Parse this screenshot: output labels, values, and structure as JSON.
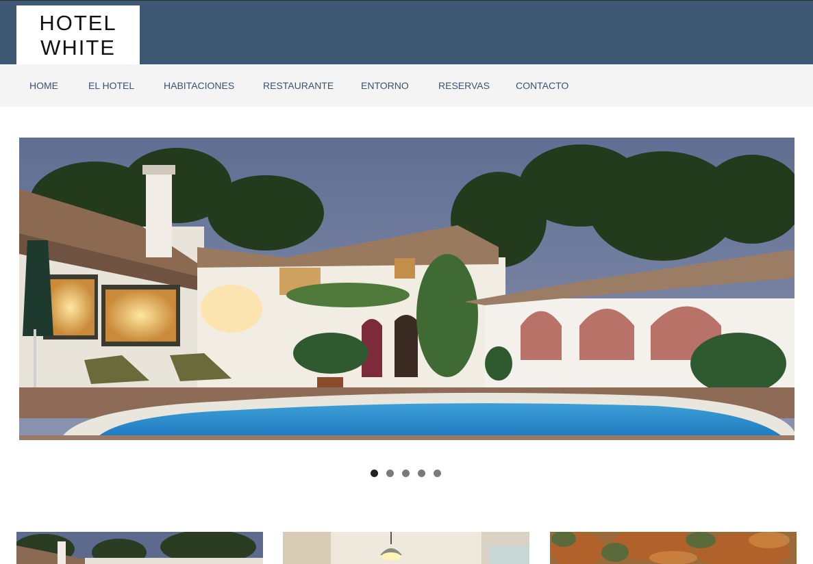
{
  "logo": {
    "line1": "HOTEL",
    "line2": "WHITE"
  },
  "nav": {
    "items": [
      {
        "label": "HOME"
      },
      {
        "label": "EL HOTEL"
      },
      {
        "label": "HABITACIONES"
      },
      {
        "label": "RESTAURANTE"
      },
      {
        "label": "ENTORNO"
      },
      {
        "label": "RESERVAS"
      },
      {
        "label": "CONTACTO"
      }
    ]
  },
  "slider": {
    "slide_count": 5,
    "active_index": 0,
    "image": "hotel-pool-night-photo"
  },
  "thumbnails": [
    {
      "image": "hotel-exterior-photo"
    },
    {
      "image": "interior-lamp-photo"
    },
    {
      "image": "autumn-forest-photo"
    }
  ],
  "colors": {
    "header_bg": "#3c5872",
    "nav_bg": "#f4f4f4",
    "nav_text": "#3a5270",
    "dot_active": "#222222",
    "dot_inactive": "#7a7a7a"
  }
}
